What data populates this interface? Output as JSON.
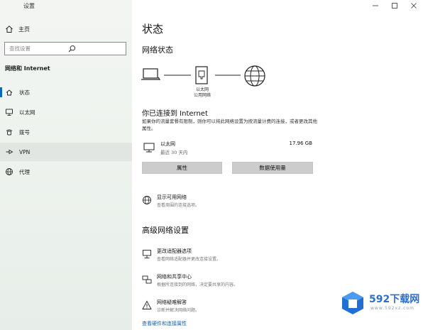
{
  "window": {
    "title": "设置",
    "controls": [
      "minimize-icon",
      "maximize-icon",
      "close-icon"
    ]
  },
  "sidebar": {
    "home_label": "主页",
    "search_placeholder": "查找设置",
    "section_title": "网络和 Internet",
    "items": [
      {
        "label": "状态",
        "icon": "home-signal-icon",
        "active": true
      },
      {
        "label": "以太网",
        "icon": "ethernet-icon"
      },
      {
        "label": "拨号",
        "icon": "dialup-icon"
      },
      {
        "label": "VPN",
        "icon": "vpn-icon"
      },
      {
        "label": "代理",
        "icon": "globe-icon"
      }
    ]
  },
  "main": {
    "page_title": "状态",
    "network_status_title": "网络状态",
    "diagram": {
      "device_icon": "laptop-icon",
      "adapter_icon": "ethernet-adapter-icon",
      "internet_icon": "globe-icon",
      "adapter_label_line1": "以太网",
      "adapter_label_line2": "公用网络"
    },
    "connected_title": "你已连接到 Internet",
    "connected_desc": "如果你的流量套餐有限制，则你可以将此网络设置为按流量计费的连接，或者更改其他属性。",
    "connection": {
      "name": "以太网",
      "period": "最近 30 天内",
      "usage": "17.96 GB"
    },
    "buttons": {
      "properties": "属性",
      "data_usage": "数据使用量"
    },
    "show_networks": {
      "title": "显示可用网络",
      "desc": "查看周围的连接选项。"
    },
    "advanced_title": "高级网络设置",
    "advanced_items": [
      {
        "title": "更改适配器选项",
        "desc": "查看网络适配器并更改连接设置。",
        "icon": "adapter-options-icon"
      },
      {
        "title": "网络和共享中心",
        "desc": "根据所连接到的网络，决定要共享的内容。",
        "icon": "sharing-center-icon"
      },
      {
        "title": "网络疑难解答",
        "desc": "诊断并解决网络问题。",
        "icon": "warning-icon"
      }
    ],
    "bottom_link": "查看硬件和连接属性"
  },
  "watermark": {
    "brand": "592下载网",
    "url": "www.592xz.com"
  },
  "colors": {
    "accent": "#0a66c2",
    "link": "#1060b0",
    "button_bg": "#cccccc",
    "sidebar_bg": "#eef3ee"
  }
}
